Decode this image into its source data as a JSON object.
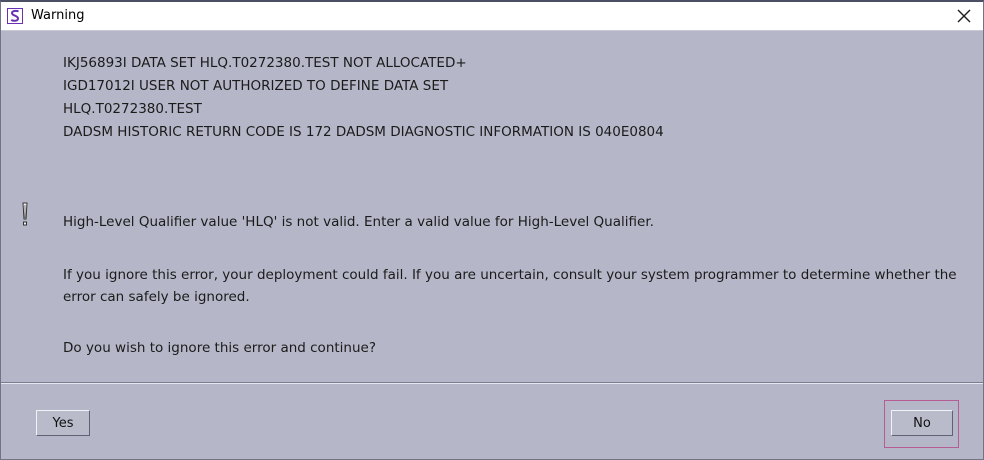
{
  "window": {
    "title": "Warning",
    "app_icon": "app-logo-icon",
    "close_icon": "close-icon"
  },
  "message": {
    "lines": [
      "IKJ56893I DATA SET HLQ.T0272380.TEST NOT ALLOCATED+",
      "IGD17012I USER NOT AUTHORIZED TO DEFINE DATA SET",
      "HLQ.T0272380.TEST",
      "DADSM HISTORIC RETURN CODE IS 172 DADSM DIAGNOSTIC INFORMATION IS 040E0804"
    ],
    "qualifier_text": "High-Level Qualifier value 'HLQ' is not valid. Enter a valid value for High-Level Qualifier.",
    "ignore_text": "If you ignore this error, your deployment could fail. If you are uncertain, consult your system programmer to determine whether the error can safely be ignored.",
    "question": "Do you wish to ignore this error and continue?"
  },
  "buttons": {
    "yes_label": "Yes",
    "no_label": "No"
  },
  "colors": {
    "dialog_bg": "#b5b7c8",
    "titlebar_bg": "#ffffff",
    "focus_border": "#b45c93",
    "app_icon": "#6a2fb3"
  }
}
